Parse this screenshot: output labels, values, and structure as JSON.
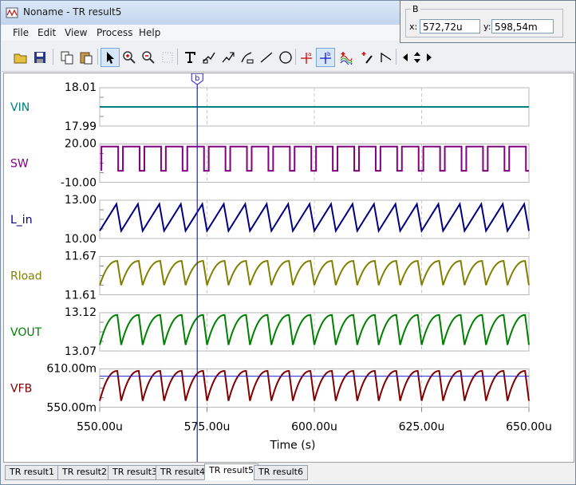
{
  "window": {
    "title": "Noname - TR result5"
  },
  "menu": [
    "File",
    "Edit",
    "View",
    "Process",
    "Help"
  ],
  "cursor_box": {
    "group_label": "B",
    "x_label": "x:",
    "x_value": "572,72u",
    "y_label": "y:",
    "y_value": "598,54m"
  },
  "cursor_marker": "b",
  "tabs": [
    "TR result1",
    "TR result2",
    "TR result3",
    "TR result4",
    "TR result5",
    "TR result6"
  ],
  "selected_tab": 4,
  "colors": {
    "VIN": "#008080",
    "SW": "#800080",
    "L_in": "#000080",
    "Rload": "#808000",
    "VOUT": "#008000",
    "VFB": "#800000",
    "cursor": "#2020d0"
  },
  "chart_data": {
    "type": "line",
    "xlabel": "Time (s)",
    "xlim": [
      550,
      650
    ],
    "xunit": "u",
    "xticks": [
      "550.00u",
      "575.00u",
      "600.00u",
      "625.00u",
      "650.00u"
    ],
    "cursor_x": 572.72,
    "switching_period": 5,
    "series": [
      {
        "name": "VIN",
        "ymin_label": "17.99",
        "ymax_label": "18.01",
        "ylim": [
          17.99,
          18.01
        ],
        "shape": "flat",
        "value": 18.0
      },
      {
        "name": "SW",
        "ymin_label": "-10.00",
        "ymax_label": "20.00",
        "ylim": [
          -10,
          20
        ],
        "shape": "square",
        "high": 18.0,
        "low": -1.0
      },
      {
        "name": "L_in",
        "ymin_label": "10.00",
        "ymax_label": "13.00",
        "ylim": [
          10,
          13
        ],
        "shape": "triangle",
        "low": 10.6,
        "high": 12.7
      },
      {
        "name": "Rload",
        "ymin_label": "11.61",
        "ymax_label": "11.67",
        "ylim": [
          11.61,
          11.67
        ],
        "shape": "ripple",
        "low": 11.625,
        "high": 11.663
      },
      {
        "name": "VOUT",
        "ymin_label": "13.07",
        "ymax_label": "13.12",
        "ylim": [
          13.07,
          13.12
        ],
        "shape": "ripple",
        "low": 13.078,
        "high": 13.117
      },
      {
        "name": "VFB",
        "ymin_label": "550.00m",
        "ymax_label": "610.00m",
        "ylim": [
          550,
          610
        ],
        "shape": "ripple",
        "low": 560,
        "high": 607,
        "cursor_y": 598.54
      }
    ]
  }
}
